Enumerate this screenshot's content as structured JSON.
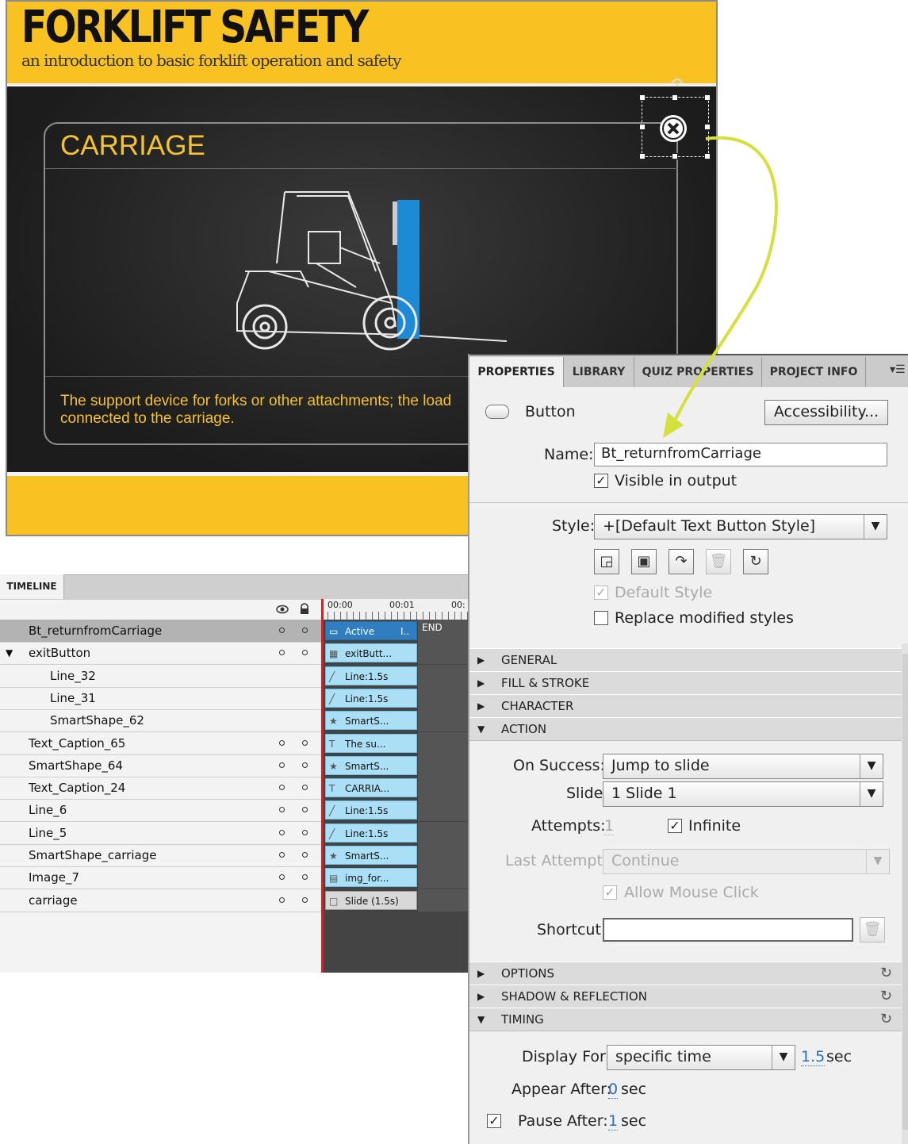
{
  "slide": {
    "title": "FORKLIFT SAFETY",
    "subtitle": "an introduction to basic forklift operation and safety",
    "card_title": "CARRIAGE",
    "card_text": "The support device for forks or other attachments; the load connected to the carriage."
  },
  "timeline": {
    "tab": "TIMELINE",
    "ruler": [
      "00:00",
      "00:01",
      "00:"
    ],
    "end_label": "END",
    "rows": [
      {
        "name": "Bt_returnfromCarriage",
        "bar": "Active",
        "bar2": "I..",
        "icon": "button"
      },
      {
        "name": "exitButton",
        "bar": "exitButt...",
        "icon": "group"
      },
      {
        "name": "Line_32",
        "bar": "Line:1.5s",
        "icon": "line"
      },
      {
        "name": "Line_31",
        "bar": "Line:1.5s",
        "icon": "line"
      },
      {
        "name": "SmartShape_62",
        "bar": "SmartS...",
        "icon": "star"
      },
      {
        "name": "Text_Caption_65",
        "bar": "The su...",
        "icon": "text"
      },
      {
        "name": "SmartShape_64",
        "bar": "SmartS...",
        "icon": "star"
      },
      {
        "name": "Text_Caption_24",
        "bar": "CARRIA...",
        "icon": "text"
      },
      {
        "name": "Line_6",
        "bar": "Line:1.5s",
        "icon": "line"
      },
      {
        "name": "Line_5",
        "bar": "Line:1.5s",
        "icon": "line"
      },
      {
        "name": "SmartShape_carriage",
        "bar": "SmartS...",
        "icon": "star"
      },
      {
        "name": "Image_7",
        "bar": "img_for...",
        "icon": "image"
      },
      {
        "name": "carriage",
        "bar": "Slide (1.5s)",
        "icon": "slide"
      }
    ]
  },
  "props": {
    "tabs": [
      "PROPERTIES",
      "LIBRARY",
      "QUIZ PROPERTIES",
      "PROJECT INFO"
    ],
    "type_label": "Button",
    "accessibility_btn": "Accessibility...",
    "name_label": "Name:",
    "name_value": "Bt_returnfromCarriage",
    "visible_label": "Visible in output",
    "style_label": "Style:",
    "style_value": "+[Default Text Button Style]",
    "default_style_label": "Default Style",
    "replace_label": "Replace modified styles",
    "sections_top": [
      "GENERAL",
      "FILL & STROKE",
      "CHARACTER",
      "ACTION"
    ],
    "on_success_label": "On Success:",
    "on_success_value": "Jump to slide",
    "slide_label": "Slide",
    "slide_value": "1 Slide 1",
    "attempts_label": "Attempts:",
    "attempts_value": "1",
    "infinite_label": "Infinite",
    "last_attempt_label": "Last Attempt:",
    "last_attempt_value": "Continue",
    "allow_mouse_label": "Allow Mouse Click",
    "shortcut_label": "Shortcut:",
    "sections_bottom": [
      "OPTIONS",
      "SHADOW & REFLECTION",
      "TIMING"
    ],
    "display_for_label": "Display For:",
    "display_for_value": "specific time",
    "display_time": "1.5",
    "sec_unit": "sec",
    "appear_after_label": "Appear After:",
    "appear_after_value": "0",
    "pause_after_label": "Pause After:",
    "pause_after_value": "1"
  },
  "colors": {
    "brand_yellow": "#f9c223",
    "caption_yellow": "#f5c231",
    "timeline_bar": "#abdff6",
    "arrow": "#d4e03b"
  },
  "icons": [
    "close-circle-icon",
    "rotate-icon",
    "eye-icon",
    "lock-icon",
    "reset-icon",
    "trash-icon",
    "save-icon"
  ]
}
